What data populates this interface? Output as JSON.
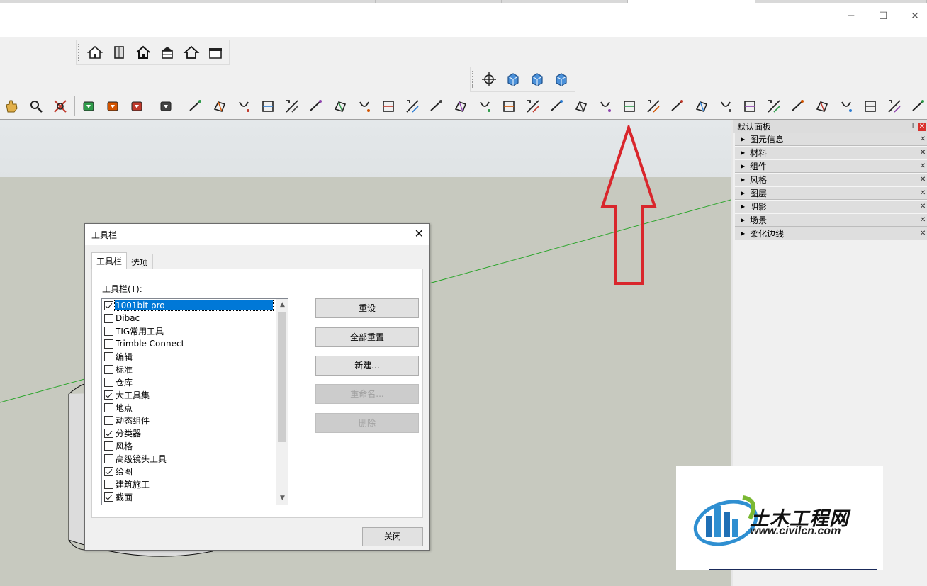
{
  "window": {
    "minimize_glyph": "─",
    "maximize_glyph": "☐",
    "close_glyph": "✕"
  },
  "toolbars": {
    "top_left_icons": [
      "house-icon",
      "door-icon",
      "home-outline-icon",
      "window-icon",
      "house-outline-icon",
      "house-front-icon"
    ],
    "views_icons": [
      "orbit-icon",
      "view-front-icon",
      "view-iso-icon",
      "view-right-icon"
    ],
    "large_tool_set_icons": [
      "hand-icon",
      "magnifier-icon",
      "zoom-extents-icon",
      "sep",
      "ruby-book-icon",
      "ruby-stack-icon",
      "ruby-export-icon",
      "sep",
      "ruby-gem-icon",
      "sep",
      "draw-line-icon",
      "push-pull-icon",
      "circle-add-icon",
      "polyline-icon",
      "erase-face-icon",
      "layers-icon",
      "color-layers-icon",
      "trim-icon",
      "rotate-shape-icon",
      "loft-icon",
      "curve-shape-icon",
      "bend-icon",
      "box-icon",
      "section-cut-icon",
      "sphere-icon",
      "follow-icon",
      "corner-icon",
      "chamfer-icon",
      "angle-icon",
      "fillet-icon",
      "frame-icon",
      "fold-icon",
      "paint-icon",
      "columns-icon",
      "fence-icon",
      "hand-stop-icon",
      "stairs-icon",
      "panel-icon",
      "slice-icon",
      "layer-stack-icon",
      "pillar-icon"
    ]
  },
  "tray": {
    "title": "默认面板",
    "pin_glyph": "📌",
    "close_glyph": "✕",
    "items": [
      {
        "label": "图元信息"
      },
      {
        "label": "材料"
      },
      {
        "label": "组件"
      },
      {
        "label": "风格"
      },
      {
        "label": "图层"
      },
      {
        "label": "阴影"
      },
      {
        "label": "场景"
      },
      {
        "label": "柔化边线"
      }
    ],
    "item_close_glyph": "✕",
    "expand_glyph": "▶"
  },
  "dialog": {
    "title": "工具栏",
    "close_glyph": "✕",
    "tabs": [
      {
        "label": "工具栏",
        "active": true
      },
      {
        "label": "选项",
        "active": false
      }
    ],
    "list_label": "工具栏(T):",
    "toolbars_list": [
      {
        "label": "1001bit pro",
        "checked": true,
        "selected": true
      },
      {
        "label": "Dibac",
        "checked": false
      },
      {
        "label": "TIG常用工具",
        "checked": false
      },
      {
        "label": "Trimble Connect",
        "checked": false
      },
      {
        "label": "编辑",
        "checked": false
      },
      {
        "label": "标准",
        "checked": false
      },
      {
        "label": "仓库",
        "checked": false
      },
      {
        "label": "大工具集",
        "checked": true
      },
      {
        "label": "地点",
        "checked": false
      },
      {
        "label": "动态组件",
        "checked": false
      },
      {
        "label": "分类器",
        "checked": true
      },
      {
        "label": "风格",
        "checked": false
      },
      {
        "label": "高级镜头工具",
        "checked": false
      },
      {
        "label": "绘图",
        "checked": true
      },
      {
        "label": "建筑施工",
        "checked": false
      },
      {
        "label": "截面",
        "checked": true
      }
    ],
    "scroll_up_glyph": "▲",
    "scroll_down_glyph": "▼",
    "buttons": {
      "reset": "重设",
      "reset_all": "全部重置",
      "new": "新建...",
      "rename": "重命名...",
      "delete": "删除"
    },
    "disabled": {
      "rename": true,
      "delete": true
    },
    "close_button": "关闭"
  },
  "watermark": {
    "name": "土木工程网",
    "url": "www.civilcn.com"
  },
  "colors": {
    "annotation_arrow": "#d9262c",
    "axis_green": "#2aa52a",
    "selection": "#0078d7"
  }
}
